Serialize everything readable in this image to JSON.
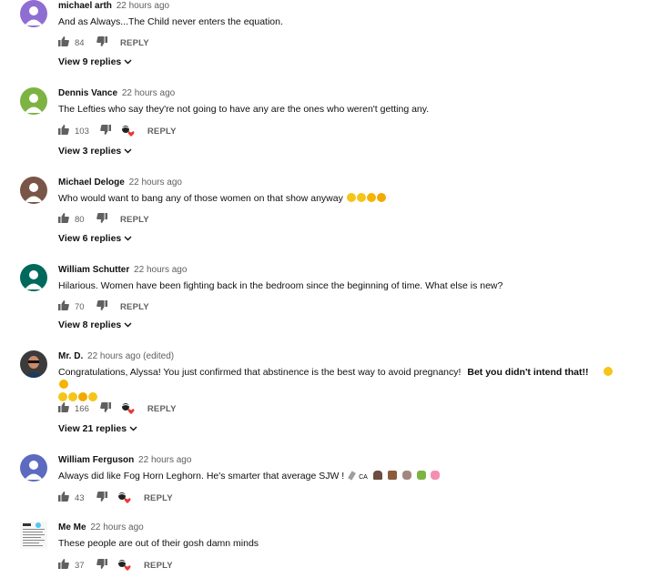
{
  "comments": [
    {
      "author": "michael arth",
      "time": "22 hours ago",
      "text": "And as Always...The Child never enters the equation.",
      "likes": "84",
      "reply": "REPLY",
      "replies": "View 9 replies",
      "avatar_color": "#8e6ed3"
    },
    {
      "author": "Dennis Vance",
      "time": "22 hours ago",
      "text": "The Lefties who say they're not going to have any are the ones who weren't getting any.",
      "likes": "103",
      "reply": "REPLY",
      "replies": "View 3 replies",
      "avatar_color": "#7cb342"
    },
    {
      "author": "Michael Deloge",
      "time": "22 hours ago",
      "text": "Who would want to bang any of those women on that show anyway",
      "likes": "80",
      "reply": "REPLY",
      "replies": "View 6 replies",
      "avatar_color": "#795548"
    },
    {
      "author": "William Schutter",
      "time": "22 hours ago",
      "text": "Hilarious. Women have been fighting back in the bedroom since the beginning of time. What else is new?",
      "likes": "70",
      "reply": "REPLY",
      "replies": "View 8 replies",
      "avatar_color": "#00695c"
    },
    {
      "author": "Mr. D.",
      "time": "22 hours ago (edited)",
      "text": "Congratulations, Alyssa! You just confirmed that abstinence is the best way to avoid pregnancy!",
      "text_bold": "Bet you didn't intend that!!",
      "likes": "166",
      "reply": "REPLY",
      "replies": "View 21 replies",
      "avatar_color": "#3b3b3b"
    },
    {
      "author": "William Ferguson",
      "time": "22 hours ago",
      "text": "Always did like Fog Horn Leghorn. He's smarter that average SJW !",
      "emoji_text": "CA",
      "likes": "43",
      "reply": "REPLY",
      "avatar_color": "#5c6bc0"
    },
    {
      "author": "Me Me",
      "time": "22 hours ago",
      "text": "These people are out of their gosh damn minds",
      "likes": "37",
      "reply": "REPLY",
      "avatar_color": "#f2f2f2"
    }
  ]
}
